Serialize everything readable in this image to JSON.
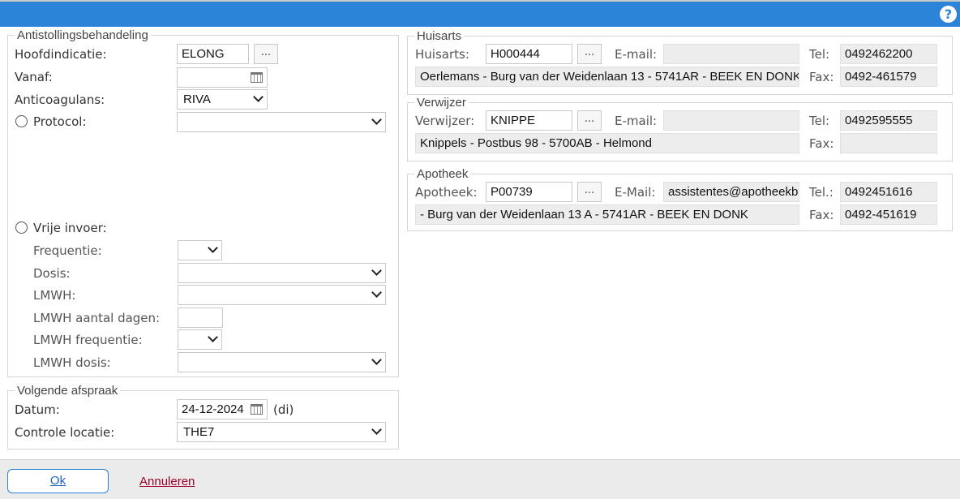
{
  "dialog": {
    "help_icon": "question-circle-icon",
    "help_glyph": "?"
  },
  "antistolling": {
    "legend": "Antistollingsbehandeling",
    "hoofdindicatie_label": "Hoofdindicatie:",
    "hoofdindicatie_value": "ELONG",
    "vanaf_label": "Vanaf:",
    "vanaf_value": "",
    "anticoagulans_label": "Anticoagulans:",
    "anticoagulans_value": "RIVA",
    "protocol_label": "Protocol:",
    "protocol_value": "",
    "vrije_invoer_label": "Vrije invoer:",
    "frequentie_label": "Frequentie:",
    "dosis_label": "Dosis:",
    "lmwh_label": "LMWH:",
    "lmwh_aantal_label": "LMWH aantal dagen:",
    "lmwh_frequentie_label": "LMWH frequentie:",
    "lmwh_dosis_label": "LMWH dosis:"
  },
  "volgende": {
    "legend": "Volgende afspraak",
    "datum_label": "Datum:",
    "datum_value": "24-12-2024",
    "day_hint": "(di)",
    "locatie_label": "Controle locatie:",
    "locatie_value": "THE7"
  },
  "huisarts": {
    "legend": "Huisarts",
    "code_label": "Huisarts:",
    "code_value": "H000444",
    "email_label": "E-mail:",
    "email_value": "",
    "tel_label": "Tel:",
    "tel_value": "0492462200",
    "fax_label": "Fax:",
    "fax_value": "0492-461579",
    "address": "Oerlemans - Burg van der Weidenlaan 13 - 5741AR - BEEK EN DONK"
  },
  "verwijzer": {
    "legend": "Verwijzer",
    "code_label": "Verwijzer:",
    "code_value": "KNIPPE",
    "email_label": "E-mail:",
    "email_value": "",
    "tel_label": "Tel:",
    "tel_value": "0492595555",
    "fax_label": "Fax:",
    "fax_value": "",
    "address": "Knippels - Postbus 98 - 5700AB - Helmond"
  },
  "apotheek": {
    "legend": "Apotheek",
    "code_label": "Apotheek:",
    "code_value": "P00739",
    "email_label": "E-Mail:",
    "email_value": "assistentes@apotheekb",
    "tel_label": "Tel.:",
    "tel_value": "0492451616",
    "fax_label": "Fax:",
    "fax_value": "0492-451619",
    "address": " - Burg van der Weidenlaan 13 A - 5741AR - BEEK EN DONK"
  },
  "footer": {
    "ok_label": "Ok",
    "cancel_label": "Annuleren"
  },
  "lookup_button_label": "..."
}
